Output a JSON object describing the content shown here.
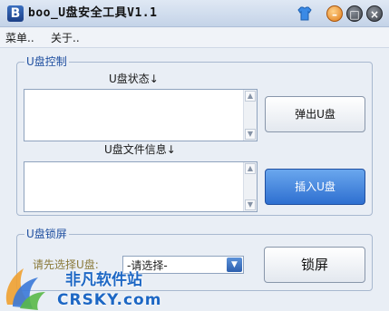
{
  "window": {
    "logo_letter": "B",
    "title": "boo_U盘安全工具V1.1",
    "skin_icon": "shirt-icon",
    "minimize_glyph": "–",
    "maximize_glyph": "□",
    "close_glyph": "×"
  },
  "menu": {
    "items": [
      "菜单..",
      "关于.."
    ]
  },
  "usb_control": {
    "legend": "U盘控制",
    "status_label": "U盘状态↓",
    "file_info_label": "U盘文件信息↓",
    "eject_button": "弹出U盘",
    "insert_button": "插入U盘"
  },
  "usb_lock": {
    "legend": "U盘锁屏",
    "prompt": "请先选择U盘:",
    "select_value": "-请选择-",
    "lock_button": "锁屏"
  },
  "watermark": {
    "line1": "非凡软件站",
    "line2": "CRSKY.com"
  },
  "colors": {
    "accent": "#2e6fd0",
    "legend_text": "#1f4fa0",
    "background": "#e9eef5"
  }
}
